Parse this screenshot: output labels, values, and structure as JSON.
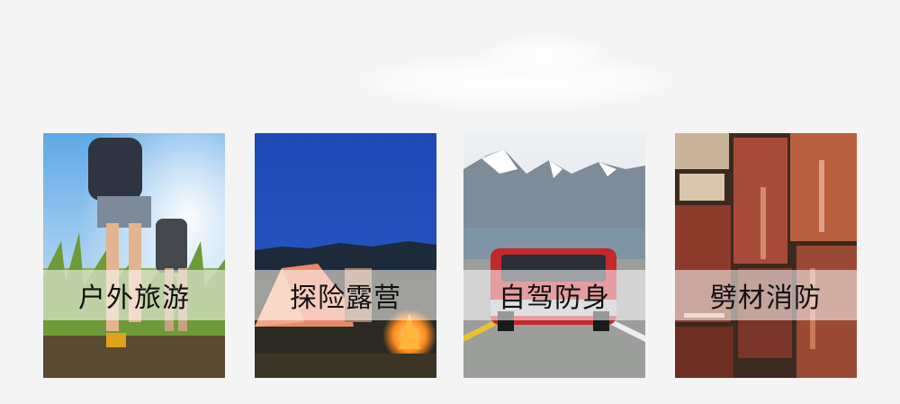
{
  "cards": [
    {
      "label": "户外旅游"
    },
    {
      "label": "探险露营"
    },
    {
      "label": "自驾防身"
    },
    {
      "label": "劈材消防"
    }
  ]
}
